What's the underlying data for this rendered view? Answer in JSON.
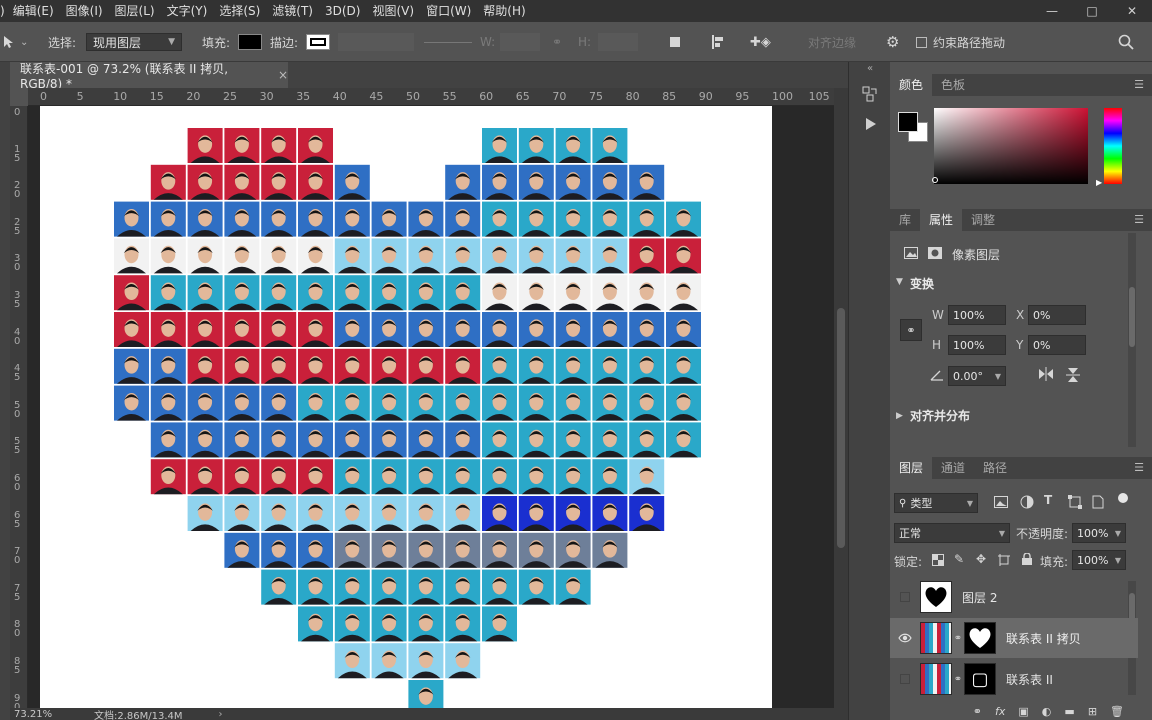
{
  "menu": [
    "编辑(E)",
    "图像(I)",
    "图层(L)",
    "文字(Y)",
    "选择(S)",
    "滤镜(T)",
    "3D(D)",
    "视图(V)",
    "窗口(W)",
    "帮助(H)"
  ],
  "menu_partial": ")",
  "optbar": {
    "select_label": "选择:",
    "select_value": "现用图层",
    "fill_label": "填充:",
    "stroke_label": "描边:",
    "w_label": "W:",
    "h_label": "H:",
    "align_edges": "对齐边缘",
    "constrain_path": "约束路径拖动"
  },
  "doc": {
    "tab_title": "联系表-001 @ 73.2% (联系表 II 拷贝, RGB/8) *",
    "close": "×"
  },
  "ruler": {
    "h": [
      "0",
      "5",
      "10",
      "15",
      "20",
      "25",
      "30",
      "35",
      "40",
      "45",
      "50",
      "55",
      "60",
      "65",
      "70",
      "75",
      "80",
      "85",
      "90",
      "95",
      "100",
      "105"
    ],
    "v": [
      "0",
      "1 5",
      "2 0",
      "2 5",
      "3 0",
      "3 5",
      "4 0",
      "4 5",
      "5 0",
      "5 5",
      "6 0",
      "6 5",
      "7 0",
      "7 5",
      "8 0",
      "8 5",
      "9 0"
    ]
  },
  "status": {
    "zoom": "73.21%",
    "doc_size": "文档:2.86M/13.4M"
  },
  "color_panel": {
    "tabs": [
      "颜色",
      "色板"
    ],
    "base_hue": "#cc1133",
    "fg": "#000000",
    "bg": "#ffffff"
  },
  "props_panel": {
    "tabs": [
      "库",
      "属性",
      "调整"
    ],
    "layer_type": "像素图层",
    "transform_title": "变换",
    "w_label": "W",
    "w_value": "100%",
    "x_label": "X",
    "x_value": "0%",
    "h_label": "H",
    "h_value": "100%",
    "y_label": "Y",
    "y_value": "0%",
    "angle": "0.00°",
    "align_title": "对齐并分布"
  },
  "layers_panel": {
    "tabs": [
      "图层",
      "通道",
      "路径"
    ],
    "kind_label": "类型",
    "blend_mode": "正常",
    "opacity_label": "不透明度:",
    "opacity_value": "100%",
    "lock_label": "锁定:",
    "fill_label": "填充:",
    "fill_value": "100%",
    "layers": [
      {
        "name": "图层 2",
        "visible": false,
        "active": false
      },
      {
        "name": "联系表 II 拷贝",
        "visible": true,
        "active": true
      },
      {
        "name": "联系表 II",
        "visible": false,
        "active": false
      }
    ]
  },
  "heart": {
    "rows": [
      {
        "start": 4,
        "cells": [
          "red",
          "red",
          "red",
          "red",
          "gap",
          "gap",
          "gap",
          "gap",
          "teal",
          "teal",
          "teal",
          "teal"
        ]
      },
      {
        "start": 3,
        "cells": [
          "red",
          "red",
          "red",
          "red",
          "red",
          "blue",
          "gap",
          "gap",
          "blue",
          "blue",
          "blue",
          "blue",
          "blue",
          "blue"
        ]
      },
      {
        "start": 2,
        "cells": [
          "blue",
          "blue",
          "blue",
          "blue",
          "blue",
          "blue",
          "blue",
          "blue",
          "blue",
          "blue",
          "teal",
          "teal",
          "teal",
          "teal",
          "teal",
          "teal"
        ]
      },
      {
        "start": 2,
        "cells": [
          "white",
          "white",
          "white",
          "white",
          "white",
          "white",
          "light",
          "light",
          "light",
          "light",
          "light",
          "light",
          "light",
          "light",
          "red",
          "red"
        ]
      },
      {
        "start": 2,
        "cells": [
          "red",
          "teal",
          "teal",
          "teal",
          "teal",
          "teal",
          "teal",
          "teal",
          "teal",
          "teal",
          "white",
          "white",
          "white",
          "white",
          "white",
          "white"
        ]
      },
      {
        "start": 2,
        "cells": [
          "red",
          "red",
          "red",
          "red",
          "red",
          "red",
          "blue",
          "blue",
          "blue",
          "blue",
          "blue",
          "blue",
          "blue",
          "blue",
          "blue",
          "blue"
        ]
      },
      {
        "start": 2,
        "cells": [
          "blue",
          "blue",
          "red",
          "red",
          "red",
          "red",
          "red",
          "red",
          "red",
          "red",
          "teal",
          "teal",
          "teal",
          "teal",
          "teal",
          "teal"
        ]
      },
      {
        "start": 2,
        "cells": [
          "blue",
          "blue",
          "blue",
          "blue",
          "blue",
          "teal",
          "teal",
          "teal",
          "teal",
          "teal",
          "teal",
          "teal",
          "teal",
          "teal",
          "teal",
          "teal"
        ]
      },
      {
        "start": 3,
        "cells": [
          "blue",
          "blue",
          "blue",
          "blue",
          "blue",
          "blue",
          "blue",
          "blue",
          "blue",
          "teal",
          "teal",
          "teal",
          "teal",
          "teal",
          "teal"
        ]
      },
      {
        "start": 3,
        "cells": [
          "red",
          "red",
          "red",
          "red",
          "red",
          "teal",
          "teal",
          "teal",
          "teal",
          "teal",
          "teal",
          "teal",
          "teal",
          "light"
        ]
      },
      {
        "start": 4,
        "cells": [
          "light",
          "light",
          "light",
          "light",
          "light",
          "light",
          "light",
          "light",
          "deepblue",
          "deepblue",
          "deepblue",
          "deepblue",
          "deepblue"
        ]
      },
      {
        "start": 5,
        "cells": [
          "blue",
          "blue",
          "blue",
          "gray",
          "gray",
          "gray",
          "gray",
          "gray",
          "gray",
          "gray",
          "gray"
        ]
      },
      {
        "start": 6,
        "cells": [
          "teal",
          "teal",
          "teal",
          "teal",
          "teal",
          "teal",
          "teal",
          "teal",
          "teal"
        ]
      },
      {
        "start": 7,
        "cells": [
          "teal",
          "teal",
          "teal",
          "teal",
          "teal",
          "teal"
        ]
      },
      {
        "start": 8,
        "cells": [
          "light",
          "light",
          "light",
          "light"
        ]
      },
      {
        "start": 10,
        "cells": [
          "teal"
        ]
      }
    ],
    "palette": {
      "red": "#c9203a",
      "blue": "#2f6fc4",
      "teal": "#2aa8c9",
      "light": "#8fd3ee",
      "white": "#f2f2f2",
      "deepblue": "#1a2fd0",
      "gray": "#6e7f99"
    }
  }
}
